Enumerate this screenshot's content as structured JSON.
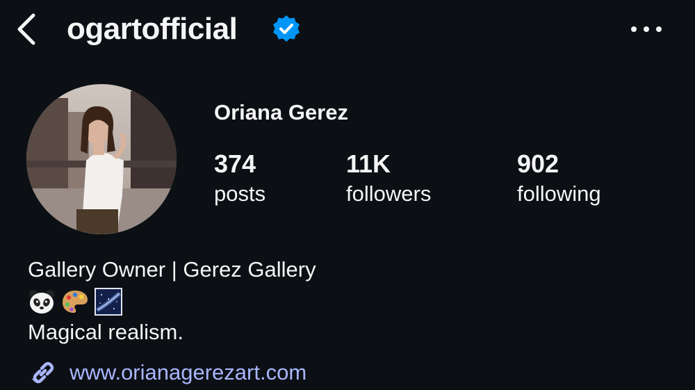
{
  "header": {
    "username": "ogartofficial",
    "verified": true,
    "back_icon": "chevron-left-icon",
    "more_icon": "more-horizontal-icon"
  },
  "profile": {
    "full_name": "Oriana Gerez",
    "stats": [
      {
        "value": "374",
        "label": "posts"
      },
      {
        "value": "11K",
        "label": "followers"
      },
      {
        "value": "902",
        "label": "following"
      }
    ]
  },
  "bio": {
    "line1": "Gallery Owner | Gerez Gallery",
    "emojis": [
      "panda-emoji",
      "artist-palette-emoji",
      "milky-way-emoji"
    ],
    "line2": "Magical realism.",
    "link": "www.orianagerezart.com"
  },
  "colors": {
    "background": "#0c1014",
    "text": "#f5f5f5",
    "verified_badge": "#0095f6",
    "link": "#a9b6ff"
  }
}
